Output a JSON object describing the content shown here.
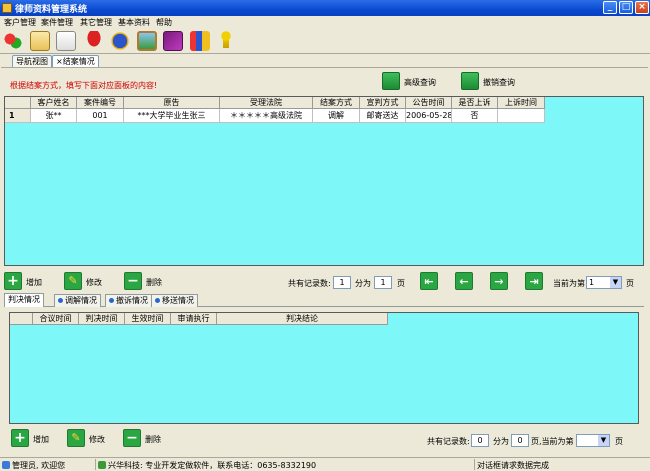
{
  "window": {
    "title": "律师资料管理系统",
    "minimize": "_",
    "maximize": "□",
    "close": "×"
  },
  "menu": [
    "客户管理",
    "案件管理",
    "其它管理",
    "基本资料",
    "帮助"
  ],
  "toolbar_icons": [
    "users-icon",
    "document-edit-icon",
    "document-pen-icon",
    "umbrella-icon",
    "alarm-clock-icon",
    "image-icon",
    "book-icon",
    "gift-icon",
    "exit-icon"
  ],
  "tabs": [
    {
      "label": "导航视图"
    },
    {
      "label": "×结案情况"
    }
  ],
  "hint": "根据结案方式，填写下面对应面板的内容!",
  "top_buttons": {
    "advanced_search": "高级查询",
    "cancel_search": "撤销查询"
  },
  "main_grid": {
    "columns": [
      "客户姓名",
      "案件编号",
      "原告",
      "受理法院",
      "结案方式",
      "宣判方式",
      "公告时间",
      "是否上诉",
      "上诉时间"
    ],
    "rows": [
      {
        "num": "1",
        "cells": [
          "张**",
          "001",
          "***大学毕业生张三",
          "＊＊＊＊＊高级法院",
          "调解",
          "邮寄送达",
          "2006-05-28",
          "否",
          ""
        ]
      }
    ]
  },
  "main_actions": {
    "add": "增加",
    "edit": "修改",
    "delete": "删除"
  },
  "pager_top": {
    "total_label": "共有记录数:",
    "total": "1",
    "split_label": "分为",
    "pages": "1",
    "pages_unit": "页",
    "current_label": "当前为第",
    "current": "1",
    "current_unit": "页"
  },
  "sub_tabs": [
    "判决情况",
    "调解情况",
    "撤诉情况",
    "移送情况"
  ],
  "sub_grid": {
    "columns": [
      "合议时间",
      "判决时间",
      "生效时间",
      "审请执行",
      "判决结论"
    ]
  },
  "sub_actions": {
    "add": "增加",
    "edit": "修改",
    "delete": "删除"
  },
  "pager_bottom": {
    "total_label": "共有记录数:",
    "total": "0",
    "split_label": "分为",
    "pages": "0",
    "current_label": "页,当前为第",
    "current": "",
    "current_unit": "页"
  },
  "status": {
    "user": "管理员, 欢迎您",
    "company": "兴华科技: 专业开发定做软件，联系电话：0635-8332190",
    "message": "对话框请求数据完成"
  },
  "colors": {
    "grid_bg": "#7df7f7",
    "hint": "#d00000",
    "title_bar": "#0a4ad1"
  }
}
